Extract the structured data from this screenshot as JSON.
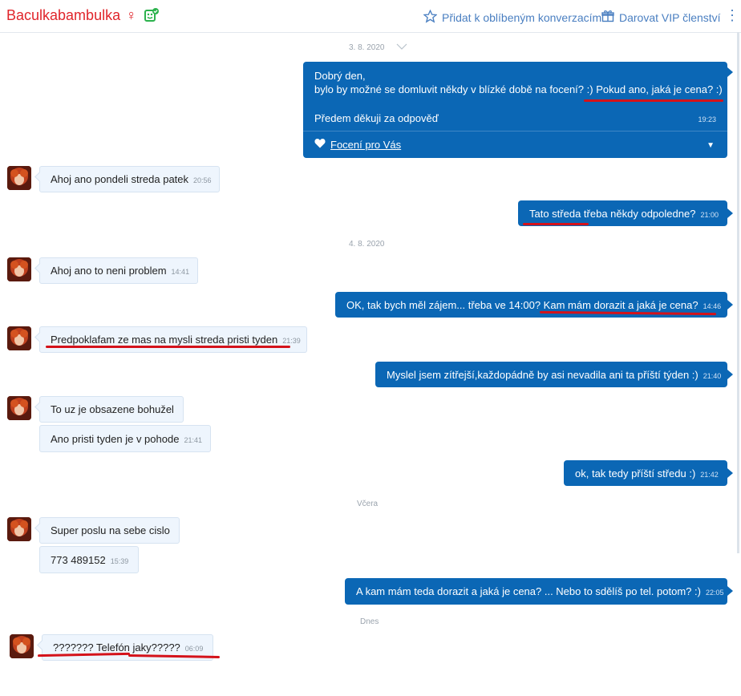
{
  "header": {
    "name": "Baculkabambulka",
    "gender_symbol": "♀",
    "favorite_label": "Přidat k oblíbeným konverzacím",
    "vip_label": "Darovat VIP členství",
    "more_symbol": "⋮"
  },
  "dividers": {
    "d1": "3. 8. 2020",
    "d2": "4. 8. 2020",
    "d3": "Včera",
    "d4": "Dnes"
  },
  "messages": {
    "m1": {
      "line1": "Dobrý den,",
      "line2": "bylo by možné se domluvit někdy v blízké době na focení? :) Pokud ano, jaká je cena? :)",
      "line3": "Předem děkuji za odpověď",
      "time": "19:23",
      "footer_label": "Focení pro Vás",
      "footer_arrow": "▼"
    },
    "m2": {
      "text": "Ahoj ano pondeli streda patek",
      "time": "20:56"
    },
    "m3": {
      "text": "Tato středa třeba někdy odpoledne?",
      "time": "21:00"
    },
    "m4": {
      "text": "Ahoj ano to neni problem",
      "time": "14:41"
    },
    "m5": {
      "text": "OK, tak bych měl zájem... třeba ve 14:00? Kam mám dorazit a jaká je cena?",
      "time": "14:46"
    },
    "m6": {
      "text": "Predpoklafam ze mas na mysli streda pristi tyden",
      "time": "21:39"
    },
    "m7": {
      "text": "Myslel jsem zítřejší,každopádně by asi nevadila ani ta příští týden :)",
      "time": "21:40"
    },
    "m8": {
      "text": "To uz je obsazene bohužel",
      "time": ""
    },
    "m9": {
      "text": "Ano pristi tyden je v pohode",
      "time": "21:41"
    },
    "m10": {
      "text": "ok, tak tedy příští středu :)",
      "time": "21:42"
    },
    "m11": {
      "text": "Super poslu na sebe cislo",
      "time": ""
    },
    "m12": {
      "text": "773 489152",
      "time": "15:39"
    },
    "m13": {
      "text": "A kam mám teda dorazit a jaká je cena? ... Nebo to sdělíš po tel. potom? :)",
      "time": "22:05"
    },
    "m14": {
      "text": "??????? Telefón jaky?????",
      "time": "06:09"
    }
  },
  "colors": {
    "accent": "#0b67b5",
    "name_red": "#e0252b",
    "underline_red": "#d4121a",
    "badge_green": "#2bb24c"
  },
  "icons": {
    "favorite": "star-outline-icon",
    "vip": "gift-icon",
    "badge": "verified-profile-icon",
    "heart": "heart-icon",
    "chevron": "chevron-down-icon"
  }
}
